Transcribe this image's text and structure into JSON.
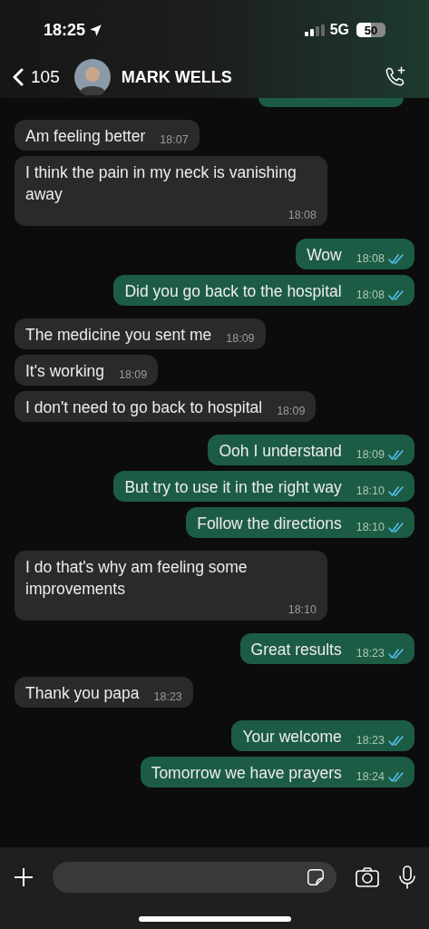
{
  "status_bar": {
    "time": "18:25",
    "network": "5G",
    "battery": "50"
  },
  "header": {
    "back_count": "105",
    "contact_name": "MARK WELLS"
  },
  "messages": [
    {
      "kind": "incoming",
      "text": "Am feeling better",
      "time": "18:07"
    },
    {
      "kind": "incoming",
      "text": "I think the pain in my neck is vanishing away",
      "time": "18:08"
    },
    {
      "kind": "outgoing",
      "text": "Wow",
      "time": "18:08",
      "read": true
    },
    {
      "kind": "outgoing",
      "text": "Did you go back to the hospital",
      "time": "18:08",
      "read": true
    },
    {
      "kind": "incoming",
      "text": "The medicine you sent me",
      "time": "18:09"
    },
    {
      "kind": "incoming",
      "text": "It's working",
      "time": "18:09"
    },
    {
      "kind": "incoming",
      "text": "I don't need to go back to hospital",
      "time": "18:09"
    },
    {
      "kind": "outgoing",
      "text": "Ooh I understand",
      "time": "18:09",
      "read": true
    },
    {
      "kind": "outgoing",
      "text": "But try to use it in the right way",
      "time": "18:10",
      "read": true
    },
    {
      "kind": "outgoing",
      "text": "Follow the directions",
      "time": "18:10",
      "read": true
    },
    {
      "kind": "incoming",
      "text": "I do that's why am feeling some improvements",
      "time": "18:10"
    },
    {
      "kind": "outgoing",
      "text": "Great results",
      "time": "18:23",
      "read": true
    },
    {
      "kind": "incoming",
      "text": "Thank you papa",
      "time": "18:23"
    },
    {
      "kind": "outgoing",
      "text": "Your welcome",
      "time": "18:23",
      "read": true
    },
    {
      "kind": "outgoing",
      "text": "Tomorrow we have prayers",
      "time": "18:24",
      "read": true
    }
  ]
}
